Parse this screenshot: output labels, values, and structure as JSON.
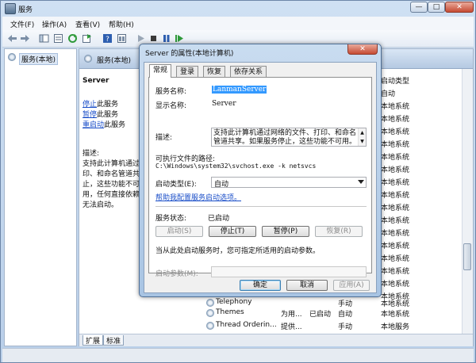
{
  "window": {
    "title": "服务",
    "minimize_glyph": "—",
    "maximize_glyph": "□",
    "close_glyph": "✕"
  },
  "menubar": {
    "items": [
      "文件(F)",
      "操作(A)",
      "查看(V)",
      "帮助(H)"
    ]
  },
  "toolbar": {
    "icons": [
      "back-arrow-icon",
      "forward-arrow-icon",
      "show-hide-tree-icon",
      "properties-list-icon",
      "refresh-icon",
      "export-icon",
      "help-icon",
      "console-icon",
      "play-icon",
      "stop-icon",
      "pause-icon",
      "restart-icon"
    ]
  },
  "tree": {
    "root_label": "服务(本地)"
  },
  "main": {
    "header_title": "服务(本地)",
    "service_title": "Server",
    "actions": [
      {
        "link": "停止",
        "suffix": "此服务"
      },
      {
        "link": "暂停",
        "suffix": "此服务"
      },
      {
        "link": "重启动",
        "suffix": "此服务"
      }
    ],
    "desc_label": "描述:",
    "desc_lines": [
      "支持此计算机通过",
      "印、和命名管道共",
      "止，这些功能不可",
      "用，任何直接依赖",
      "无法启动。"
    ],
    "list_header_startup": "启动类型",
    "startup_col": [
      "自动",
      "本地系统",
      "本地系统",
      "本地系统",
      "本地系统",
      "本地系统",
      "本地系统",
      "本地系统",
      "本地系统",
      "本地系统",
      "本地系统",
      "本地系统",
      "本地系统",
      "本地系统",
      "本地系统",
      "本地系统",
      "本地系统",
      "本地系统",
      "本地系统"
    ],
    "rows_visible": [
      {
        "name": "Telephony",
        "desc": "",
        "status": "",
        "startup": "手动",
        "logon": "本地系统"
      },
      {
        "name": "Themes",
        "desc": "为用...",
        "status": "已启动",
        "startup": "自动",
        "logon": "本地系统"
      },
      {
        "name": "Thread Orderin...",
        "desc": "提供...",
        "status": "",
        "startup": "手动",
        "logon": "本地服务"
      }
    ],
    "bottom_tabs": [
      "扩展",
      "标准"
    ]
  },
  "dialog": {
    "title": "Server 的属性(本地计算机)",
    "close_glyph": "✕",
    "tabs": [
      "常规",
      "登录",
      "恢复",
      "依存关系"
    ],
    "service_name_label": "服务名称:",
    "service_name": "LanmanServer",
    "display_name_label": "显示名称:",
    "display_name": "Server",
    "description_label": "描述:",
    "description": "支持此计算机通过网络的文件、打印、和命名管道共享。如果服务停止，这些功能不可用。",
    "exe_path_label": "可执行文件的路径:",
    "exe_path": "C:\\Windows\\system32\\svchost.exe -k netsvcs",
    "startup_type_label": "启动类型(E):",
    "startup_type": "自动",
    "help_link": "帮助我配置服务启动选项。",
    "status_label": "服务状态:",
    "status_value": "已启动",
    "buttons": {
      "start": "启动(S)",
      "stop": "停止(T)",
      "pause": "暂停(P)",
      "resume": "恢复(R)"
    },
    "hint": "当从此处启动服务时，您可指定所适用的启动参数。",
    "params_label": "启动参数(M):",
    "params_value": "",
    "footer": {
      "ok": "确定",
      "cancel": "取消",
      "apply": "应用(A)"
    }
  }
}
